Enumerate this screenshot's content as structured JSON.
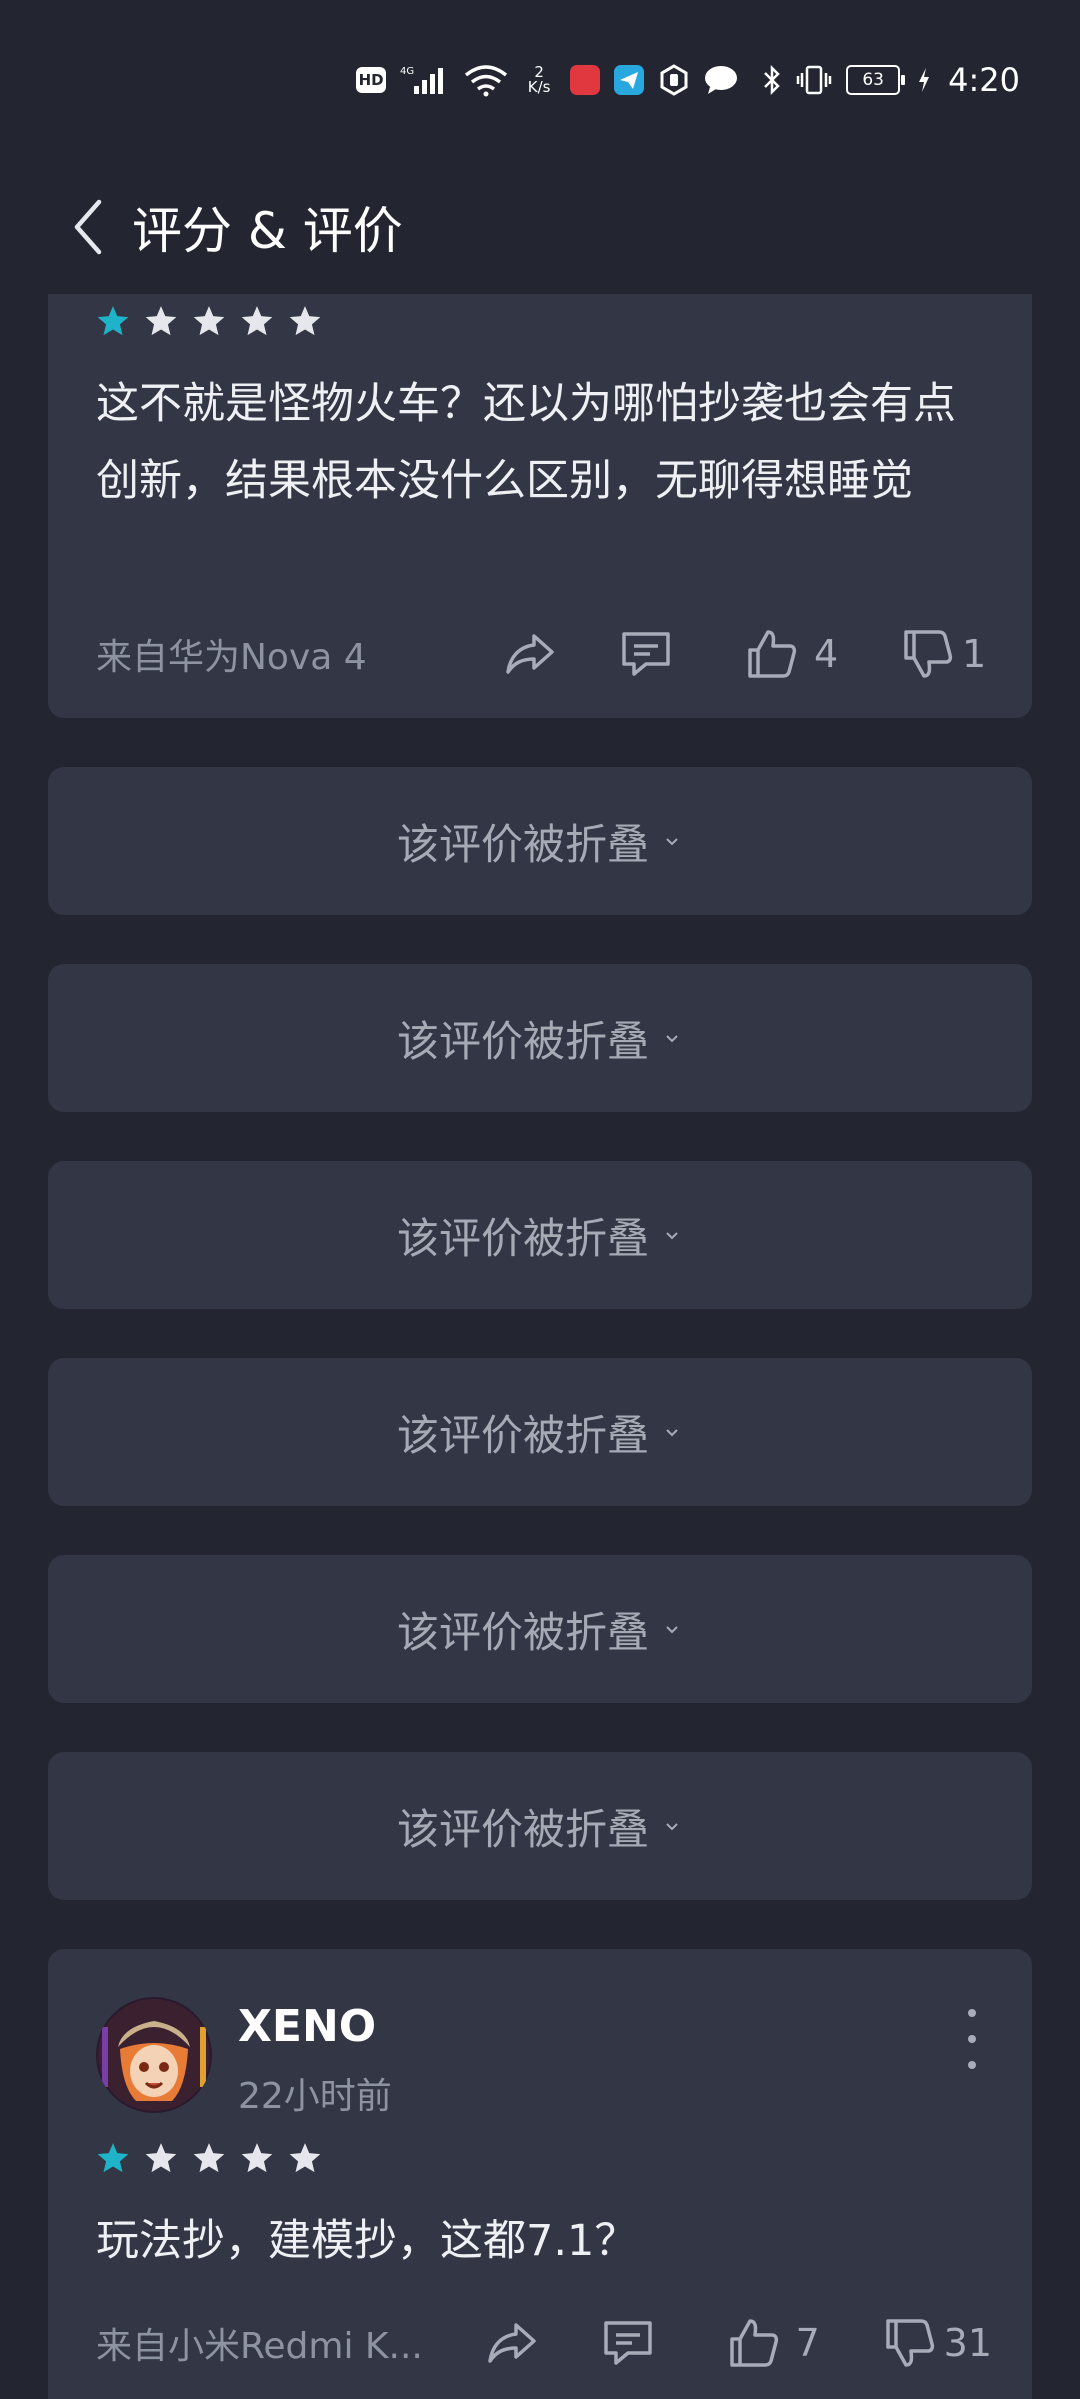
{
  "status_bar": {
    "hd": "HD",
    "net_speed_value": "2",
    "net_speed_unit": "K/s",
    "battery": "63",
    "time": "4:20"
  },
  "header": {
    "title": "评分 & 评价"
  },
  "colors": {
    "star_active": "#1fb3c9",
    "star_inactive": "#e5e7ec",
    "card_bg": "#333745",
    "page_bg": "#232630"
  },
  "reviews": [
    {
      "rating": 1,
      "text": "这不就是怪物火车？还以为哪怕抄袭也会有点创新，结果根本没什么区别，无聊得想睡觉",
      "device": "来自华为Nova 4",
      "likes": "4",
      "dislikes": "1"
    },
    {
      "username": "XENO",
      "time_ago": "22小时前",
      "rating": 1,
      "text": "玩法抄，建模抄，这都7.1？",
      "device": "来自小米Redmi K...",
      "likes": "7",
      "dislikes": "31"
    }
  ],
  "folded_label": "该评价被折叠"
}
